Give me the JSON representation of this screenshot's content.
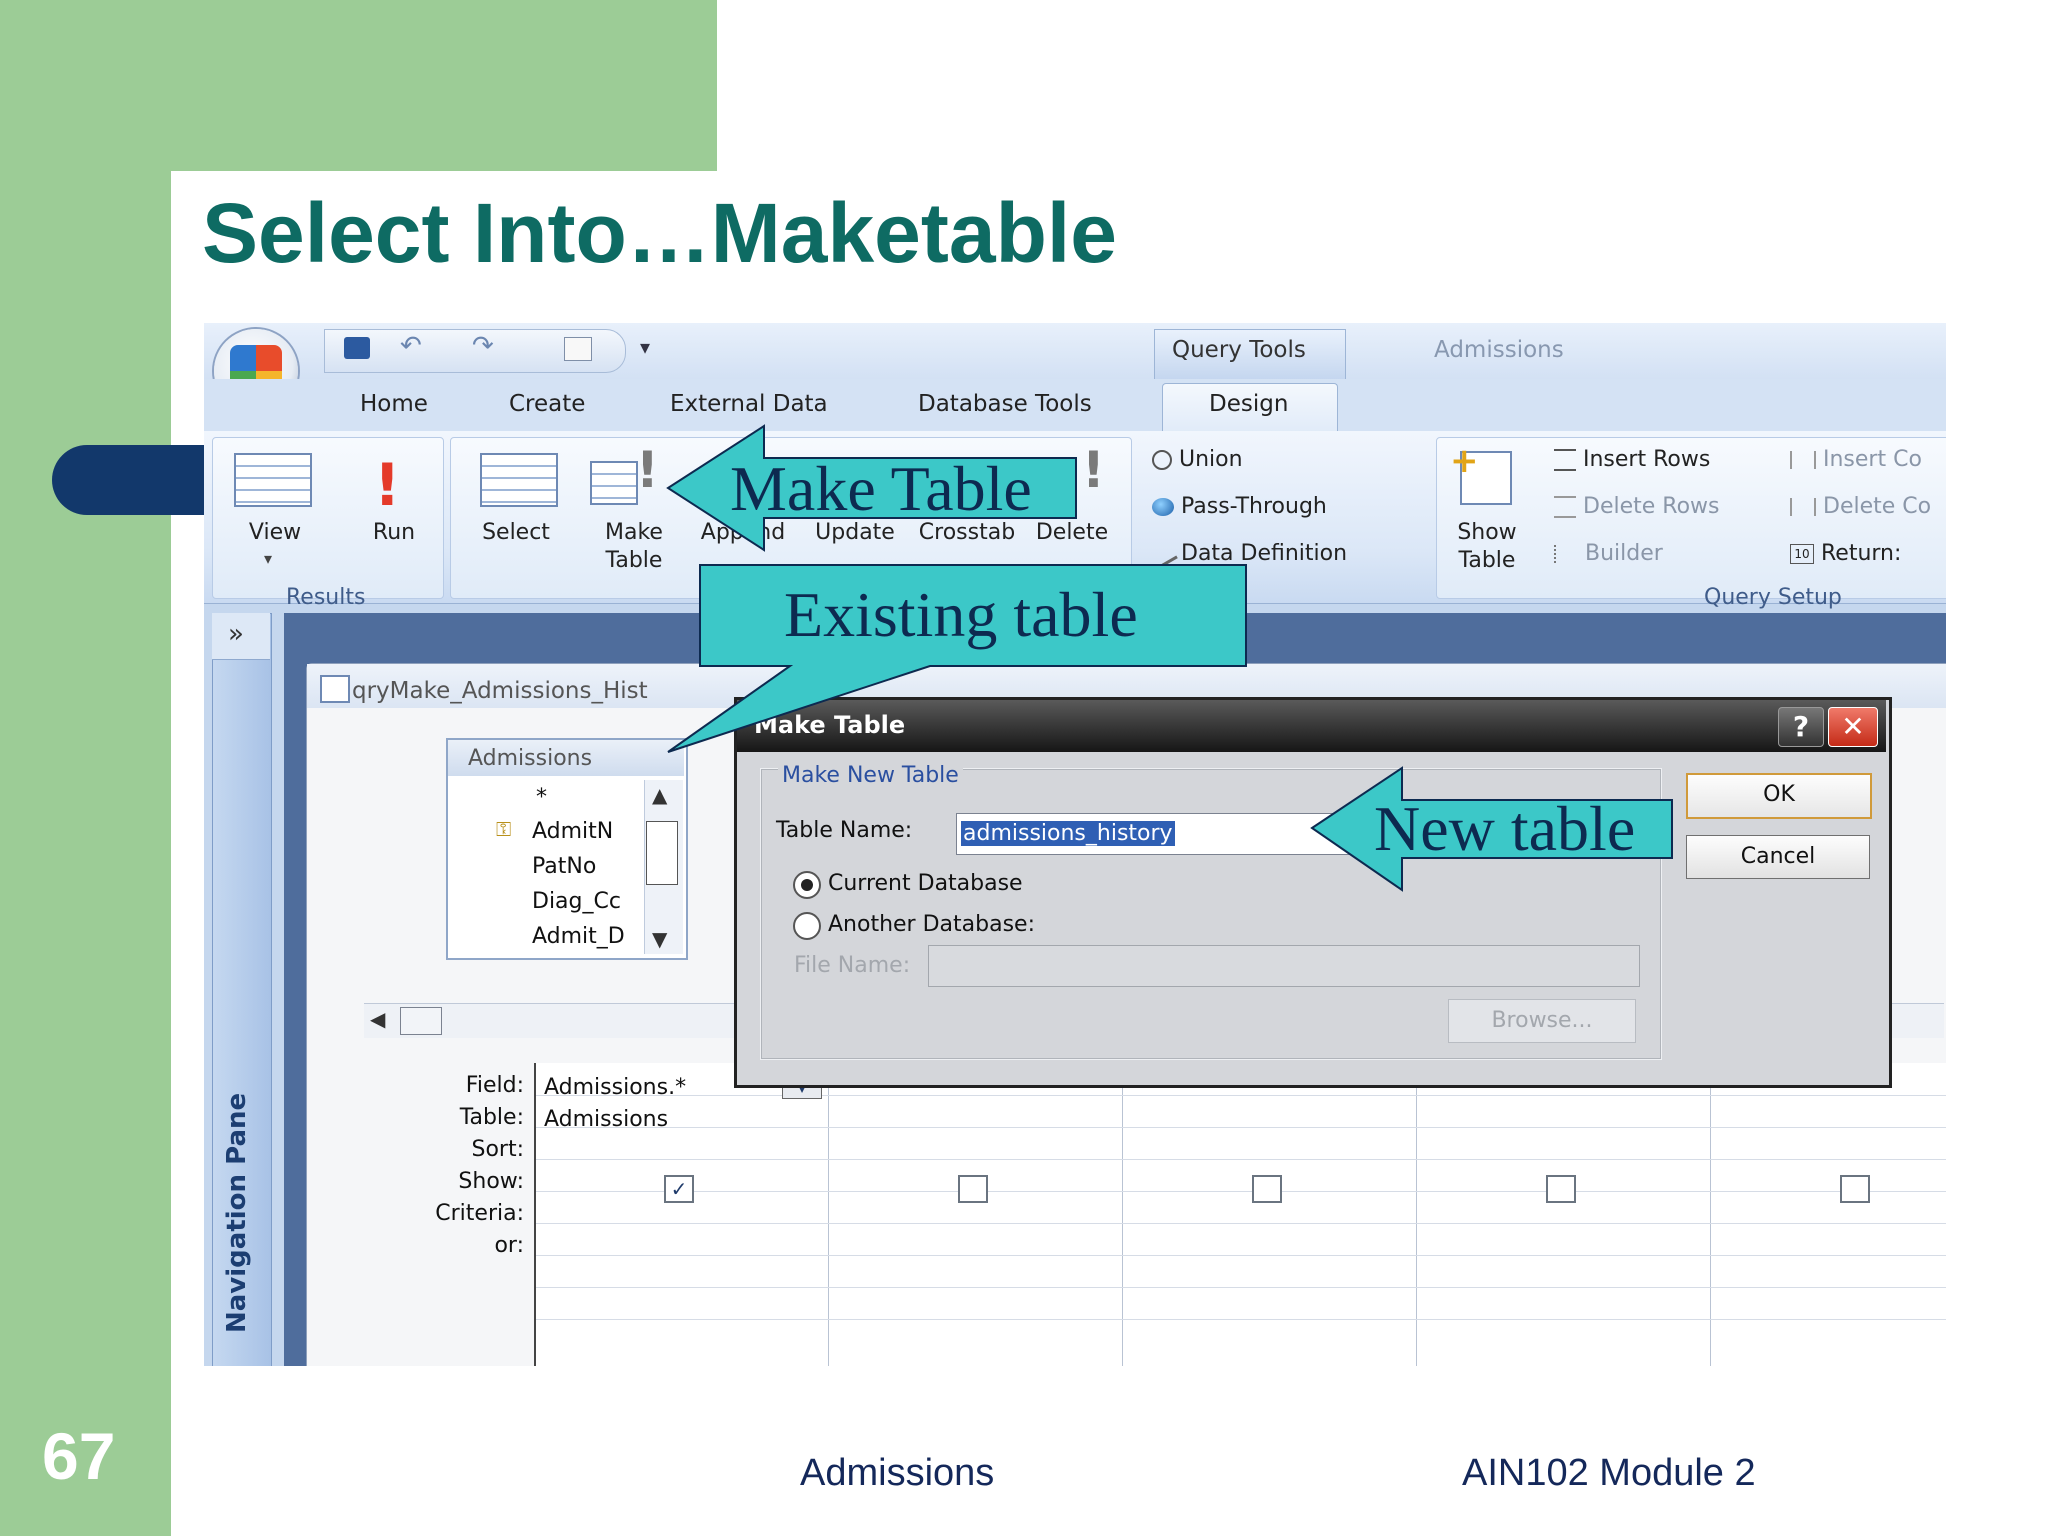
{
  "slide": {
    "title": "Select Into…Maketable",
    "number": "67",
    "footer_center": "Admissions",
    "footer_right": "AIN102  Module 2"
  },
  "window": {
    "contextual_tab": "Query Tools",
    "app_title": "Admissions"
  },
  "ribbon": {
    "tabs": [
      "Home",
      "Create",
      "External Data",
      "Database Tools",
      "Design"
    ],
    "results": {
      "view": "View",
      "run": "Run",
      "label": "Results"
    },
    "query_type": {
      "select": "Select",
      "make_table": "Make\nTable",
      "append": "Append",
      "update": "Update",
      "crosstab": "Crosstab",
      "delete": "Delete",
      "union": "Union",
      "pass_through": "Pass-Through",
      "data_definition": "Data Definition"
    },
    "query_setup": {
      "show_table": "Show\nTable",
      "insert_rows": "Insert Rows",
      "delete_rows": "Delete Rows",
      "builder": "Builder",
      "insert_cols": "Insert Co",
      "delete_cols": "Delete Co",
      "return": "Return:",
      "return_icon": "10",
      "label": "Query Setup"
    }
  },
  "nav_pane": {
    "label": "Navigation Pane",
    "toggle": "»"
  },
  "query_window": {
    "title": "qryMake_Admissions_Hist",
    "table": {
      "name": "Admissions",
      "fields": [
        "*",
        "AdmitN",
        "PatNo",
        "Diag_Cc",
        "Admit_D"
      ]
    },
    "grid": {
      "row_labels": [
        "Field:",
        "Table:",
        "Sort:",
        "Show:",
        "Criteria:",
        "or:"
      ],
      "col1_field": "Admissions.*",
      "col1_table": "Admissions",
      "show_checked": [
        true,
        false,
        false,
        false,
        false
      ]
    }
  },
  "dialog": {
    "title": "Make Table",
    "help": "?",
    "close": "✕",
    "group_label": "Make New Table",
    "table_name_label": "Table Name:",
    "table_name_value": "admissions_history",
    "current_db": "Current Database",
    "another_db": "Another Database:",
    "file_name_label": "File Name:",
    "browse": "Browse...",
    "ok": "OK",
    "cancel": "Cancel",
    "selected_option": "Current Database"
  },
  "callouts": {
    "make_table": "Make Table",
    "existing_table": "Existing table",
    "new_table": "New table",
    "fill_color": "#3cc8c8"
  }
}
